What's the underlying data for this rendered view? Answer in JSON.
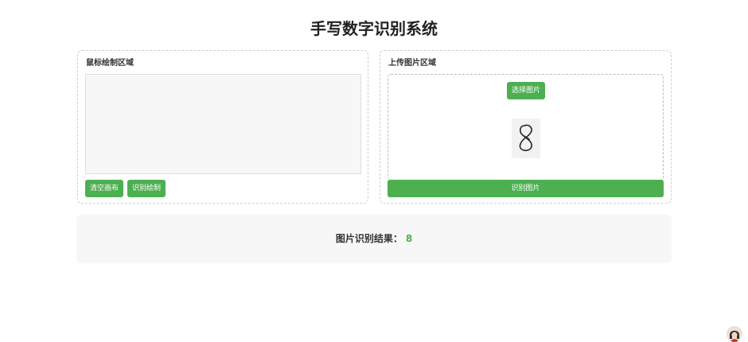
{
  "page": {
    "title": "手写数字识别系统"
  },
  "draw_panel": {
    "heading": "鼠标绘制区域",
    "clear_button": "清空画布",
    "recognize_button": "识别绘制"
  },
  "upload_panel": {
    "heading": "上传图片区域",
    "choose_button": "选择图片",
    "recognize_button": "识别图片",
    "preview_icon": "handwritten-digit-8"
  },
  "result": {
    "label": "图片识别结果：",
    "value": "8"
  },
  "colors": {
    "accent": "#4caf50",
    "panel_bg": "#f7f7f7"
  }
}
